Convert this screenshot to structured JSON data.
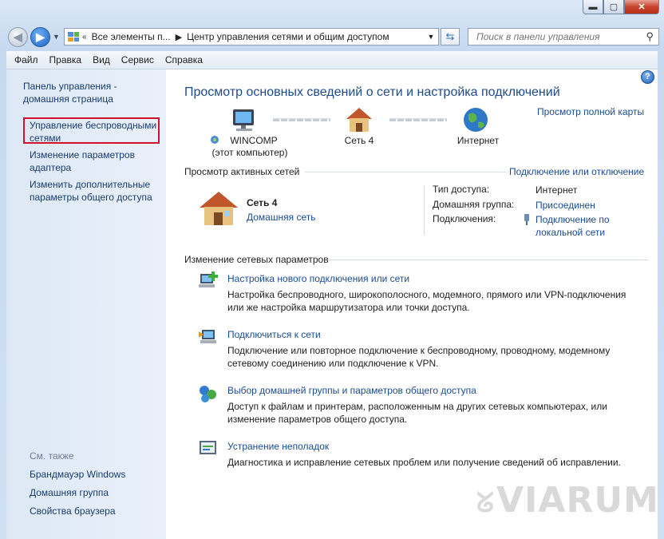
{
  "window": {
    "address_parts": [
      "Все элементы п...",
      "Центр управления сетями и общим доступом"
    ],
    "search_placeholder": "Поиск в панели управления"
  },
  "menu": [
    "Файл",
    "Правка",
    "Вид",
    "Сервис",
    "Справка"
  ],
  "sidebar": {
    "home_line1": "Панель управления -",
    "home_line2": "домашняя страница",
    "wireless_line1": "Управление беспроводными",
    "wireless_line2": "сетями",
    "adapter_line1": "Изменение параметров",
    "adapter_line2": "адаптера",
    "sharing_line1": "Изменить дополнительные",
    "sharing_line2": "параметры общего доступа",
    "see_also": "См. также",
    "firewall": "Брандмауэр Windows",
    "homegroup": "Домашняя группа",
    "browser": "Свойства браузера"
  },
  "main": {
    "title": "Просмотр основных сведений о сети и настройка подключений",
    "full_map": "Просмотр полной карты",
    "computer_name": "WINCOMP",
    "computer_sub": "(этот компьютер)",
    "network_node": "Сеть  4",
    "internet_node": "Интернет",
    "active_header": "Просмотр активных сетей",
    "connect_link": "Подключение или отключение",
    "net_name": "Сеть  4",
    "net_type": "Домашняя сеть",
    "access_label": "Тип доступа:",
    "access_value": "Интернет",
    "homegroup_label": "Домашняя группа:",
    "homegroup_value": "Присоединен",
    "connections_label": "Подключения:",
    "connections_value1": "Подключение по",
    "connections_value2": "локальной сети",
    "change_header": "Изменение сетевых параметров",
    "opt1_title": "Настройка нового подключения или сети",
    "opt1_desc1": "Настройка беспроводного, широкополосного, модемного, прямого или VPN-подключения",
    "opt1_desc2": "или же настройка маршрутизатора или точки доступа.",
    "opt2_title": "Подключиться к сети",
    "opt2_desc1": "Подключение или повторное подключение к беспроводному, проводному, модемному",
    "opt2_desc2": "сетевому соединению или подключение к VPN.",
    "opt3_title": "Выбор домашней группы и параметров общего доступа",
    "opt3_desc1": "Доступ к файлам и принтерам, расположенным на других сетевых компьютерах, или",
    "opt3_desc2": "изменение параметров общего доступа.",
    "opt4_title": "Устранение неполадок",
    "opt4_desc1": "Диагностика и исправление сетевых проблем или получение сведений об исправлении."
  },
  "watermark": "VIARUM",
  "icons": [
    "back-arrow-icon",
    "forward-arrow-icon",
    "network-center-icon",
    "refresh-icon",
    "search-icon",
    "help-icon",
    "computer-icon",
    "house-icon",
    "globe-icon",
    "network-setup-icon",
    "connect-icon",
    "homegroup-icon",
    "troubleshoot-icon"
  ]
}
